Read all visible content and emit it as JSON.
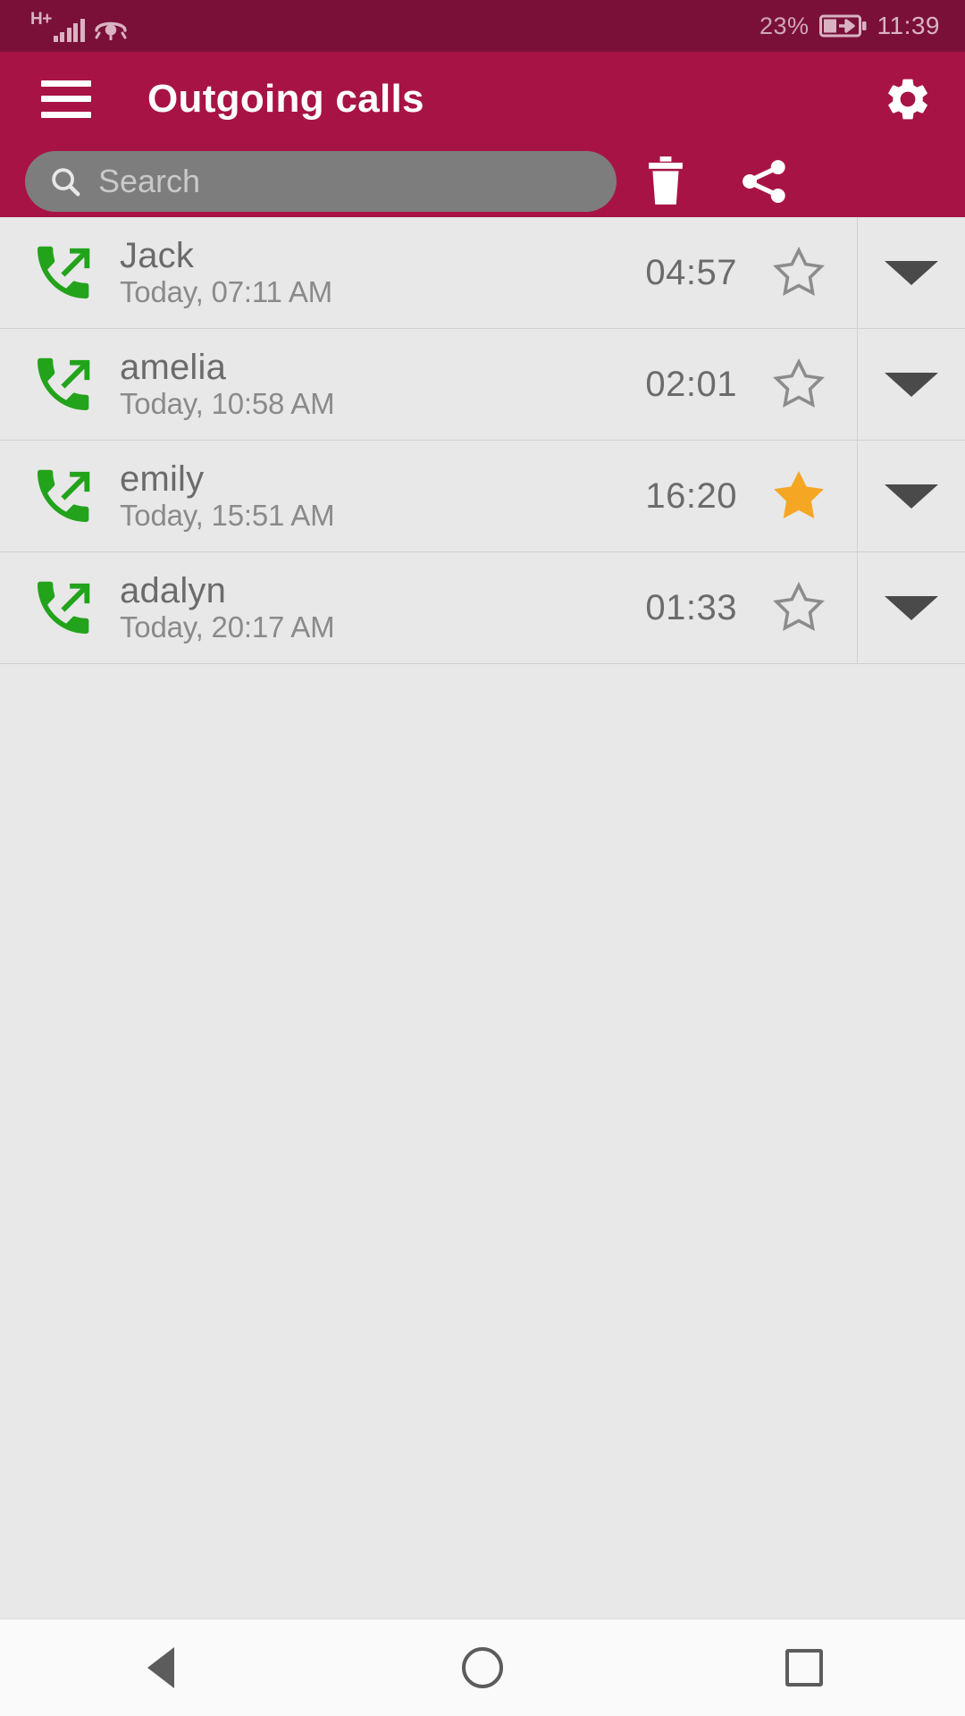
{
  "statusbar": {
    "network_type": "H+",
    "signal_icon": "signal-bars-icon",
    "eye_icon": "eye-icon",
    "battery_percent": "23%",
    "battery_icon": "battery-charging-icon",
    "time": "11:39"
  },
  "appbar": {
    "menu_icon": "hamburger-menu-icon",
    "title": "Outgoing calls",
    "settings_icon": "gear-icon",
    "bg_color": "#a81346"
  },
  "search": {
    "icon": "search-icon",
    "placeholder": "Search",
    "value": "",
    "delete_icon": "trash-icon",
    "share_icon": "share-icon"
  },
  "calls": [
    {
      "call_type_icon": "outgoing-call-icon",
      "name": "Jack",
      "timestamp": "Today, 07:11 AM",
      "duration": "04:57",
      "favorite": false,
      "expand_icon": "chevron-down-icon"
    },
    {
      "call_type_icon": "outgoing-call-icon",
      "name": "amelia",
      "timestamp": "Today, 10:58 AM",
      "duration": "02:01",
      "favorite": false,
      "expand_icon": "chevron-down-icon"
    },
    {
      "call_type_icon": "outgoing-call-icon",
      "name": "emily",
      "timestamp": "Today, 15:51 AM",
      "duration": "16:20",
      "favorite": true,
      "expand_icon": "chevron-down-icon"
    },
    {
      "call_type_icon": "outgoing-call-icon",
      "name": "adalyn",
      "timestamp": "Today, 20:17 AM",
      "duration": "01:33",
      "favorite": false,
      "expand_icon": "chevron-down-icon"
    }
  ],
  "navbar": {
    "back_icon": "back-triangle-icon",
    "home_icon": "home-circle-icon",
    "recents_icon": "recents-square-icon"
  },
  "colors": {
    "statusbar_bg": "#7a1038",
    "appbar_bg": "#a81346",
    "list_bg": "#e8e8e8",
    "call_green": "#23a31b",
    "star_gold": "#f5a623",
    "search_pill": "#7d7d7d"
  }
}
